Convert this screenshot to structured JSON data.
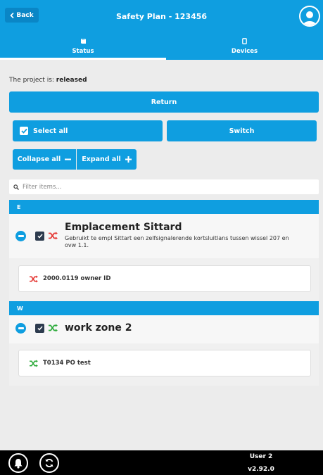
{
  "header": {
    "back_label": "Back",
    "title": "Safety Plan - 123456",
    "tabs": [
      {
        "label": "Status"
      },
      {
        "label": "Devices"
      }
    ]
  },
  "status": {
    "prefix": "The project is:",
    "value": "released"
  },
  "actions": {
    "return_label": "Return",
    "select_all_label": "Select all",
    "switch_label": "Switch",
    "collapse_label": "Collapse all",
    "expand_label": "Expand all"
  },
  "filter": {
    "placeholder": "Filter items..."
  },
  "groups": [
    {
      "letter": "E",
      "name": "Emplacement Sittard",
      "description": "Gebruikt te empl Sittart een zelfsignalerende kortsluitlans tussen wissel 207 en ovw 1.1.",
      "item": "2000.0119 owner ID",
      "status_color": "#e53935"
    },
    {
      "letter": "W",
      "name": "work zone 2",
      "description": "",
      "item": "T0134 PO test",
      "status_color": "#2eab3c"
    }
  ],
  "footer": {
    "user": "User 2",
    "version": "v2.92.0"
  },
  "colors": {
    "accent": "#0f9ee0",
    "danger": "#e53935",
    "success": "#2eab3c"
  }
}
